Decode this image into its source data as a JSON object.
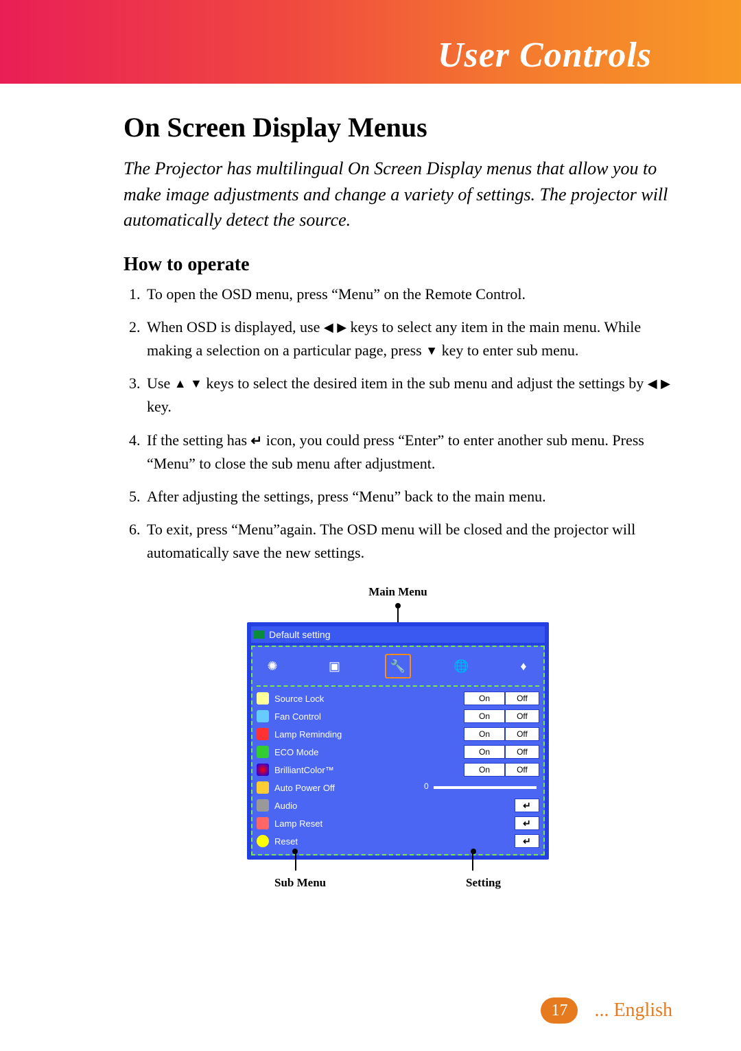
{
  "header": {
    "title": "User Controls"
  },
  "section": {
    "title": "On Screen Display Menus",
    "intro": "The Projector has multilingual On Screen Display menus that allow you to make image adjustments and change a variety of settings. The projector will automatically detect the source.",
    "subtitle": "How to operate",
    "steps": {
      "s1": "To open the OSD menu, press “Menu” on the Remote Control.",
      "s2a": "When OSD is displayed, use ",
      "s2b": " keys to select any item in the main menu. While making a selection on a particular page, press ",
      "s2c": " key to enter sub menu.",
      "s3a": "Use ",
      "s3b": " keys to select the desired item in the sub menu and adjust the settings by ",
      "s3c": " key.",
      "s4a": "If the setting has ",
      "s4b": " icon, you could press “Enter” to enter another sub menu. Press “Menu” to close the sub menu after adjustment.",
      "s5": "After adjusting the settings, press “Menu” back to the main menu.",
      "s6": "To exit, press “Menu”again. The OSD menu will be closed and the projector will automatically save the new settings."
    }
  },
  "diagram": {
    "main_menu_label": "Main Menu",
    "sub_menu_label": "Sub Menu",
    "setting_label": "Setting",
    "osd_title": "Default setting",
    "on": "On",
    "off": "Off",
    "slider_value": "0",
    "rows": {
      "r0": "Source Lock",
      "r1": "Fan Control",
      "r2": "Lamp Reminding",
      "r3": "ECO Mode",
      "r4": "BrilliantColor™",
      "r5": "Auto Power Off",
      "r6": "Audio",
      "r7": "Lamp Reset",
      "r8": "Reset"
    }
  },
  "footer": {
    "page": "17",
    "lang": "... English"
  }
}
